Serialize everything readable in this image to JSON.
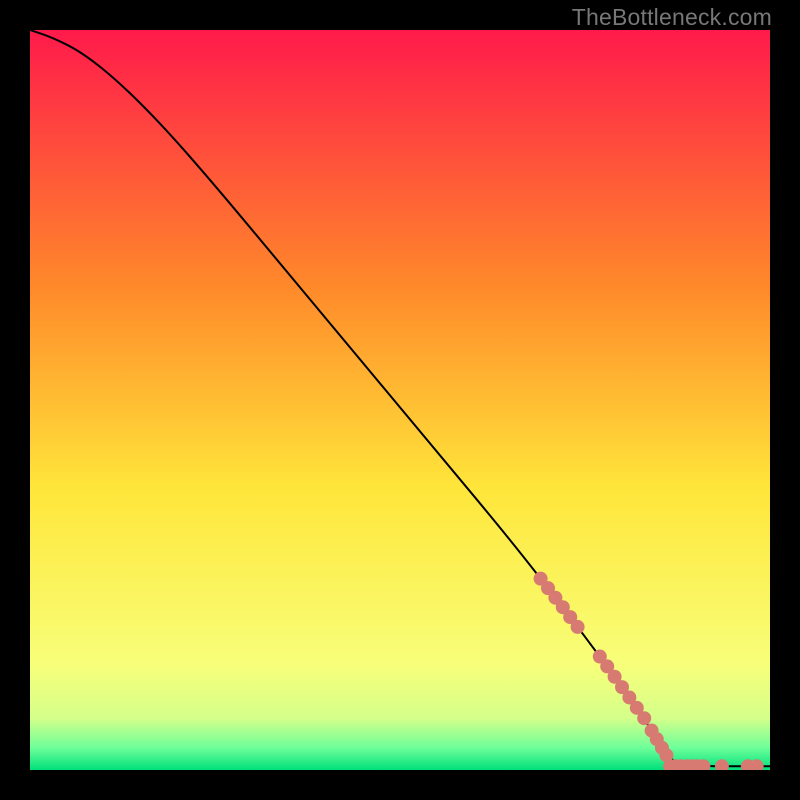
{
  "watermark": "TheBottleneck.com",
  "chart_data": {
    "type": "line",
    "title": "",
    "xlabel": "",
    "ylabel": "",
    "xlim": [
      0,
      100
    ],
    "ylim": [
      0,
      100
    ],
    "grid": false,
    "background_gradient": {
      "top": "#ff1a4b",
      "mid1": "#ff8a2a",
      "mid2": "#ffe63a",
      "mid3": "#f7ff7a",
      "bottom_band_top": "#d4ff8a",
      "bottom_band_mid": "#6eff9a",
      "bottom": "#00e07a"
    },
    "curve": {
      "description": "Monotone decreasing curve from top-left to bottom-right; slight ease-out near the top, near-linear through the middle, flattening to zero near x≈87 then flat to the right edge.",
      "points": [
        {
          "x": 0,
          "y": 100
        },
        {
          "x": 3,
          "y": 99
        },
        {
          "x": 7,
          "y": 97
        },
        {
          "x": 12,
          "y": 93
        },
        {
          "x": 18,
          "y": 87
        },
        {
          "x": 25,
          "y": 79
        },
        {
          "x": 35,
          "y": 67
        },
        {
          "x": 45,
          "y": 55
        },
        {
          "x": 55,
          "y": 43
        },
        {
          "x": 65,
          "y": 31
        },
        {
          "x": 72,
          "y": 22
        },
        {
          "x": 78,
          "y": 14
        },
        {
          "x": 83,
          "y": 7
        },
        {
          "x": 86,
          "y": 2
        },
        {
          "x": 88,
          "y": 0.5
        },
        {
          "x": 100,
          "y": 0.5
        }
      ]
    },
    "markers": {
      "color": "#d77a72",
      "radius_px": 7,
      "on_curve_cluster_x": [
        69,
        70,
        71,
        72,
        73,
        74,
        77,
        78,
        79,
        80,
        81,
        82,
        83,
        84,
        84.7,
        85.4,
        86
      ],
      "on_baseline_cluster_x": [
        86.5,
        87.2,
        88,
        88.8,
        89.5,
        90.2,
        91,
        93.5,
        97,
        98.2
      ]
    }
  }
}
